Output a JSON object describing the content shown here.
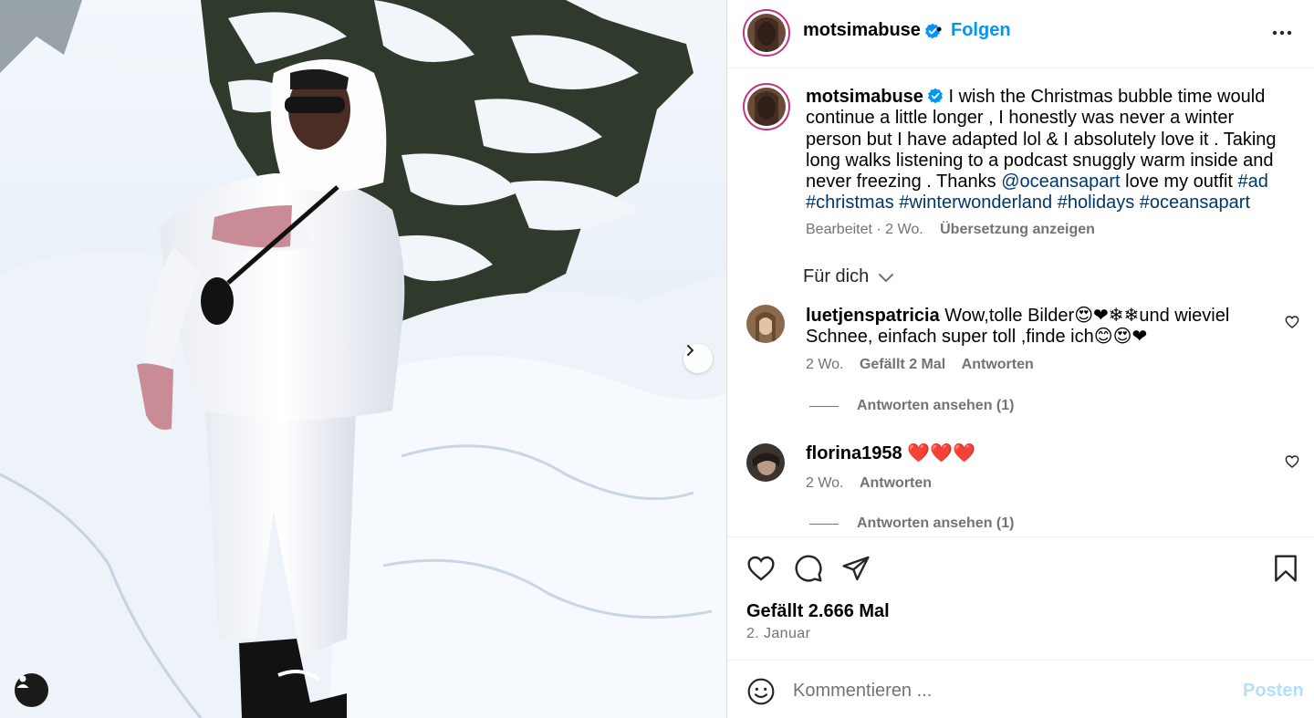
{
  "post": {
    "author": "motsimabuse",
    "follow_label": "Folgen",
    "separator": "•"
  },
  "caption": {
    "username": "motsimabuse",
    "text_before_mention": "I wish the Christmas bubble time would continue a little longer , I honestly was never a winter person but I have adapted lol & I absolutely love it . Taking long walks listening to a podcast snuggly warm inside and never freezing . Thanks",
    "mention": "@oceansapart",
    "text_after_mention": "love my outfit",
    "hashtags": [
      "#ad",
      "#christmas",
      "#winterwonderland",
      "#holidays",
      "#oceansapart"
    ],
    "edited_label": "Bearbeitet",
    "meta_dot": "·",
    "age": "2 Wo.",
    "translate_label": "Übersetzung anzeigen"
  },
  "filter": {
    "label": "Für dich"
  },
  "comments": [
    {
      "username": "luetjenspatricia",
      "text": "Wow,tolle Bilder😍❤❄❄und wieviel Schnee, einfach super toll ,finde ich😊😍❤",
      "age": "2 Wo.",
      "likes_label": "Gefällt 2 Mal",
      "reply_label": "Antworten",
      "view_replies_label": "Antworten ansehen (1)"
    },
    {
      "username": "florina1958",
      "text": "❤️❤️❤️",
      "age": "2 Wo.",
      "reply_label": "Antworten",
      "view_replies_label": "Antworten ansehen (1)"
    }
  ],
  "stats": {
    "likes_label": "Gefällt 2.666 Mal",
    "date": "2. Januar"
  },
  "comment_box": {
    "placeholder": "Kommentieren ...",
    "post_label": "Posten"
  },
  "icons": {
    "verified": "verified-badge-icon",
    "more": "more-options-icon",
    "like": "heart-icon",
    "comment": "comment-icon",
    "share": "share-icon",
    "save": "bookmark-icon",
    "emoji": "emoji-icon",
    "next": "chevron-right-icon",
    "tag": "user-tag-icon"
  },
  "colors": {
    "link": "#00376b",
    "follow": "#0095f6",
    "muted": "#737373",
    "post_disabled": "#b2dffc"
  }
}
